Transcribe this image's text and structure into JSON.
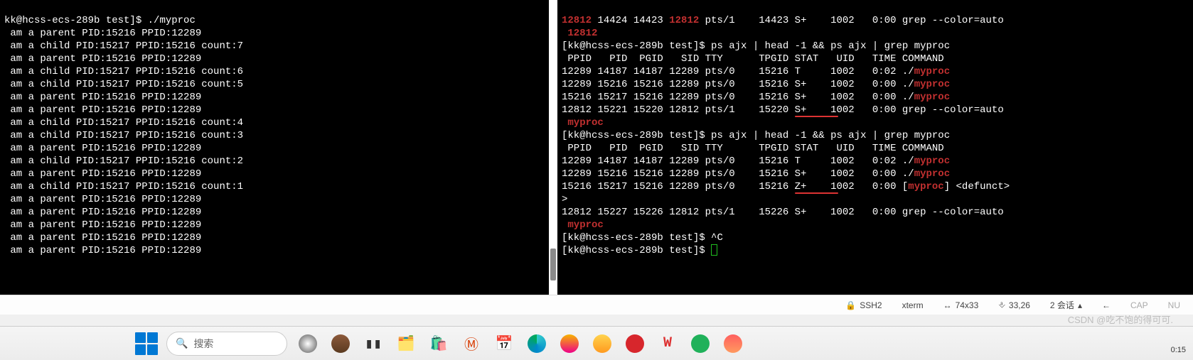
{
  "left": {
    "prompt": "kk@hcss-ecs-289b test]$ ",
    "cmd": "./myproc",
    "lines": [
      " am a parent PID:15216 PPID:12289",
      " am a child PID:15217 PPID:15216 count:7",
      " am a parent PID:15216 PPID:12289",
      " am a child PID:15217 PPID:15216 count:6",
      " am a child PID:15217 PPID:15216 count:5",
      " am a parent PID:15216 PPID:12289",
      " am a parent PID:15216 PPID:12289",
      " am a child PID:15217 PPID:15216 count:4",
      " am a child PID:15217 PPID:15216 count:3",
      " am a parent PID:15216 PPID:12289",
      " am a child PID:15217 PPID:15216 count:2",
      " am a parent PID:15216 PPID:12289",
      " am a child PID:15217 PPID:15216 count:1",
      " am a parent PID:15216 PPID:12289",
      " am a parent PID:15216 PPID:12289",
      " am a parent PID:15216 PPID:12289",
      " am a parent PID:15216 PPID:12289",
      " am a parent PID:15216 PPID:12289"
    ]
  },
  "right": {
    "top_line_a": "12812",
    "top_line_b": " 14424 14423 ",
    "top_line_c": "12812",
    "top_line_d": " pts/1    14423 S+    1002   0:00 grep --color=auto",
    "top_pid": " 12812",
    "prompt": "[kk@hcss-ecs-289b test]$ ",
    "cmd_ps": "ps ajx | head -1 && ps ajx | grep myproc",
    "header": " PPID   PID  PGID   SID TTY      TPGID STAT   UID   TIME COMMAND",
    "block1": [
      {
        "pre": "12289 14187 14187 12289 pts/0    15216 T     1002   0:02 ./",
        "proc": "myproc"
      },
      {
        "pre": "12289 15216 15216 12289 pts/0    15216 S+    1002   0:00 ./",
        "proc": "myproc"
      },
      {
        "pre": "15216 15217 15216 12289 pts/0    15216 S+    1002   0:00 ./",
        "proc": "myproc"
      }
    ],
    "b1_tail_a": "12812 15221 15220 12812 pts/1    15220 ",
    "b1_tail_stat": "S+",
    "b1_tail_b": "    1002   0:00 grep --color=auto",
    "b1_tail_proc": " myproc",
    "block2": [
      {
        "pre": "12289 14187 14187 12289 pts/0    15216 T     1002   0:02 ./",
        "proc": "myproc"
      },
      {
        "pre": "12289 15216 15216 12289 pts/0    15216 S+    1002   0:00 ./",
        "proc": "myproc"
      }
    ],
    "zombie_a": "15216 15217 15216 12289 pts/0    15216 ",
    "zombie_stat": "Z+",
    "zombie_b": "    1002   0:00 [",
    "zombie_proc": "myproc",
    "zombie_c": "] <defunct>",
    "gt": ">",
    "b2_tail": "12812 15227 15226 12812 pts/1    15226 S+    1002   0:00 grep --color=auto",
    "b2_tail_proc": " myproc",
    "ctrlc": "^C"
  },
  "status": {
    "ssh": "SSH2",
    "term": "xterm",
    "size": "74x33",
    "pos": "33,26",
    "sessions": "2 会话",
    "cap": "CAP",
    "num": "NU"
  },
  "watermark": "CSDN @吃不饱的得可可.",
  "taskbar": {
    "search_placeholder": "搜索"
  },
  "clock": "0:15"
}
